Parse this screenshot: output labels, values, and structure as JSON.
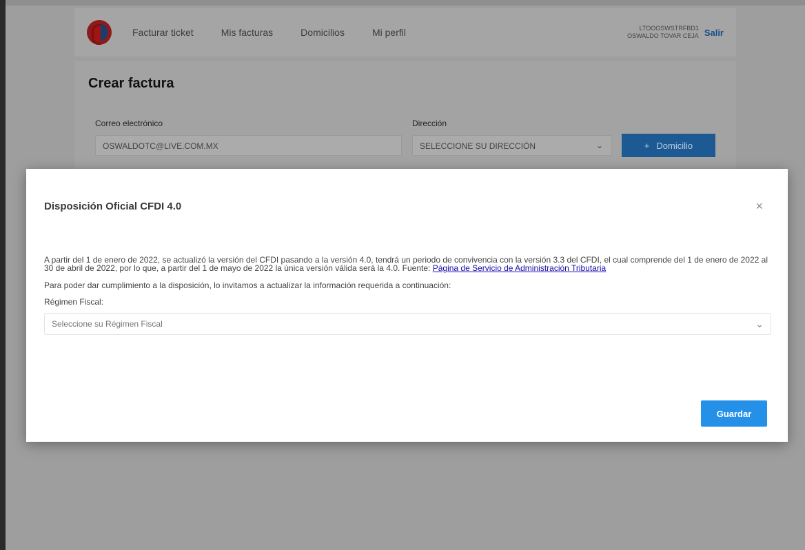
{
  "nav": {
    "links": [
      "Facturar ticket",
      "Mis facturas",
      "Domicilios",
      "Mi perfil"
    ],
    "user_line1": "LTOOOSWSTRFBD1",
    "user_line2": "OSWALDO TOVAR CEJA",
    "exit_label": "Salir"
  },
  "page": {
    "title": "Crear factura",
    "email_label": "Correo electrónico",
    "email_value": "OSWALDOTC@LIVE.COM.MX",
    "address_label": "Dirección",
    "address_value": "SELECCIONE SU DIRECCIÓN",
    "add_address_label": "Domicilio",
    "add_icon": "+"
  },
  "modal": {
    "title": "Disposición Oficial CFDI 4.0",
    "close_icon": "×",
    "paragraph1": "A partir del 1 de enero de 2022, se actualizó la versión del CFDI pasando a la versión 4.0, tendrá un periodo de convivencia con la versión 3.3 del CFDI, el cual comprende del 1 de enero de 2022 al 30 de abril de 2022, por lo que, a partir del 1 de mayo de 2022 la única versión válida será la 4.0. Fuente:",
    "source_link": "Página de Servicio de Administración Tributaria",
    "paragraph2": "Para poder dar cumplimiento a la disposición, lo invitamos a actualizar la información requerida a continuación:",
    "regimen_label": "Régimen Fiscal:",
    "regimen_placeholder": "Seleccione su Régimen Fiscal",
    "save_label": "Guardar"
  },
  "colors": {
    "primary_button": "#2490e8",
    "link": "#1a0dab",
    "overlay": "#9e9e9e"
  }
}
